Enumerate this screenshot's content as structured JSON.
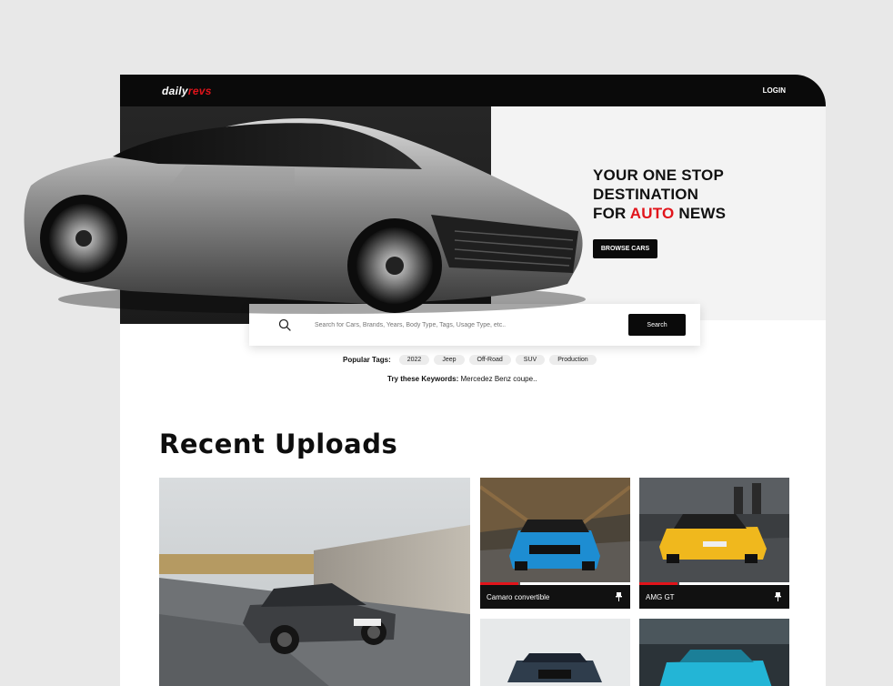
{
  "topbar": {
    "logo_prefix": "daily",
    "logo_suffix": "revs",
    "login": "LOGIN"
  },
  "hero": {
    "headline_line1": "YOUR ONE STOP",
    "headline_line2": "DESTINATION",
    "headline_line3_pre": "FOR ",
    "headline_line3_red": "AUTO",
    "headline_line3_post": " NEWS",
    "browse_button": "BROWSE CARS"
  },
  "search": {
    "placeholder": "Search for Cars, Brands, Years, Body Type, Tags, Usage Type, etc..",
    "button": "Search"
  },
  "popular_tags": {
    "label": "Popular Tags:",
    "items": [
      "2022",
      "Jeep",
      "Off-Road",
      "SUV",
      "Production"
    ]
  },
  "keywords": {
    "label": "Try these Keywords:",
    "value": " Mercedez Benz coupe.."
  },
  "recent": {
    "title": "Recent Uploads",
    "cards": [
      {
        "caption": "Camaro convertible"
      },
      {
        "caption": "AMG GT"
      }
    ]
  },
  "colors": {
    "accent": "#e1141b",
    "dark": "#0a0a0a"
  }
}
